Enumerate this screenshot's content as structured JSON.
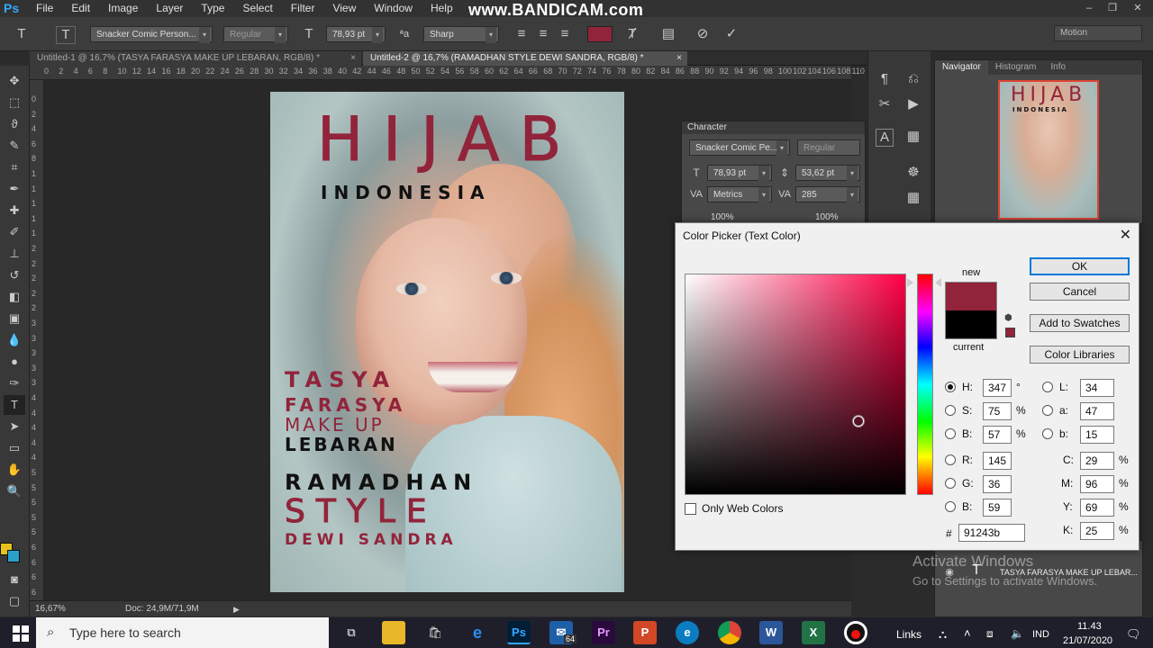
{
  "app": {
    "logo": "Ps"
  },
  "menu": [
    "File",
    "Edit",
    "Image",
    "Layer",
    "Type",
    "Select",
    "Filter",
    "View",
    "Window",
    "Help"
  ],
  "watermark": "www.BANDICAM.com",
  "window_controls": [
    "–",
    "❐",
    "✕"
  ],
  "options": {
    "font_family": "Snacker Comic Person...",
    "font_style": "Regular",
    "font_size": "78,93 pt",
    "antialias": "Sharp",
    "text_color": "#91243b",
    "workspace": "Motion"
  },
  "tabs": [
    {
      "label": "Untitled-1 @ 16,7% (TASYA FARASYA MAKE UP LEBARAN, RGB/8) *",
      "close": "×"
    },
    {
      "label": "Untitled-2 @ 16,7% (RAMADHAN STYLE DEWI SANDRA, RGB/8) *",
      "close": "×"
    }
  ],
  "ruler_top": [
    "0",
    "2",
    "4",
    "6",
    "8",
    "10",
    "12",
    "14",
    "16",
    "18",
    "20",
    "22",
    "24",
    "26",
    "28",
    "30",
    "32",
    "34",
    "36",
    "38",
    "40",
    "42",
    "44",
    "46",
    "48",
    "50",
    "52",
    "54",
    "56",
    "58",
    "60",
    "62",
    "64",
    "66",
    "68",
    "70",
    "72",
    "74",
    "76",
    "78",
    "80",
    "82",
    "84",
    "86",
    "88",
    "90",
    "92",
    "94",
    "96",
    "98",
    "100",
    "102",
    "104",
    "106",
    "108",
    "110"
  ],
  "ruler_left": [
    "0",
    "2",
    "4",
    "6",
    "8",
    "1",
    "1",
    "1",
    "1",
    "1",
    "2",
    "2",
    "2",
    "2",
    "2",
    "3",
    "3",
    "3",
    "3",
    "3",
    "4",
    "4",
    "4",
    "4",
    "4",
    "5",
    "5",
    "5",
    "5",
    "5",
    "6",
    "6",
    "6",
    "6"
  ],
  "poster": {
    "title": "HIJAB",
    "subtitle": "INDONESIA",
    "line1": "TASYA",
    "line2": "FARASYA",
    "line3": "MAKE UP",
    "line4": "LEBARAN",
    "line5": "RAMADHAN",
    "line6": "STYLE",
    "line7": "DEWI SANDRA"
  },
  "character_panel": {
    "title": "Character",
    "font": "Snacker Comic Pe...",
    "style": "Regular",
    "size": "78,93 pt",
    "leading": "53,62 pt",
    "kerning": "Metrics",
    "tracking": "285",
    "vscale": "100%",
    "hscale": "100%"
  },
  "navigator": {
    "tabs": [
      "Navigator",
      "Histogram",
      "Info"
    ],
    "thumb_title": "HIJAB",
    "thumb_sub": "INDONESIA"
  },
  "layers": {
    "layer_name": "TASYA FARASYA MAKE UP LEBAR..."
  },
  "status": {
    "zoom": "16,67%",
    "doc": "Doc: 24,9M/71,9M"
  },
  "color_picker": {
    "title": "Color Picker (Text Color)",
    "close": "✕",
    "new_label": "new",
    "current_label": "current",
    "new_color": "#91243b",
    "current_color": "#000000",
    "ok": "OK",
    "cancel": "Cancel",
    "add_to_swatches": "Add to Swatches",
    "color_libraries": "Color Libraries",
    "only_web": "Only Web Colors",
    "H": "347",
    "S": "75",
    "B": "57",
    "R": "145",
    "G": "36",
    "Bv": "59",
    "L": "34",
    "a": "47",
    "b": "15",
    "C": "29",
    "M": "96",
    "Y": "69",
    "K": "25",
    "hex": "91243b",
    "deg": "°",
    "pct": "%"
  },
  "activate": {
    "line1": "Activate Windows",
    "line2": "Go to Settings to activate Windows."
  },
  "taskbar": {
    "search_placeholder": "Type here to search",
    "links": "Links",
    "lang": "IND",
    "time": "11.43",
    "date": "21/07/2020",
    "badge": "64"
  }
}
